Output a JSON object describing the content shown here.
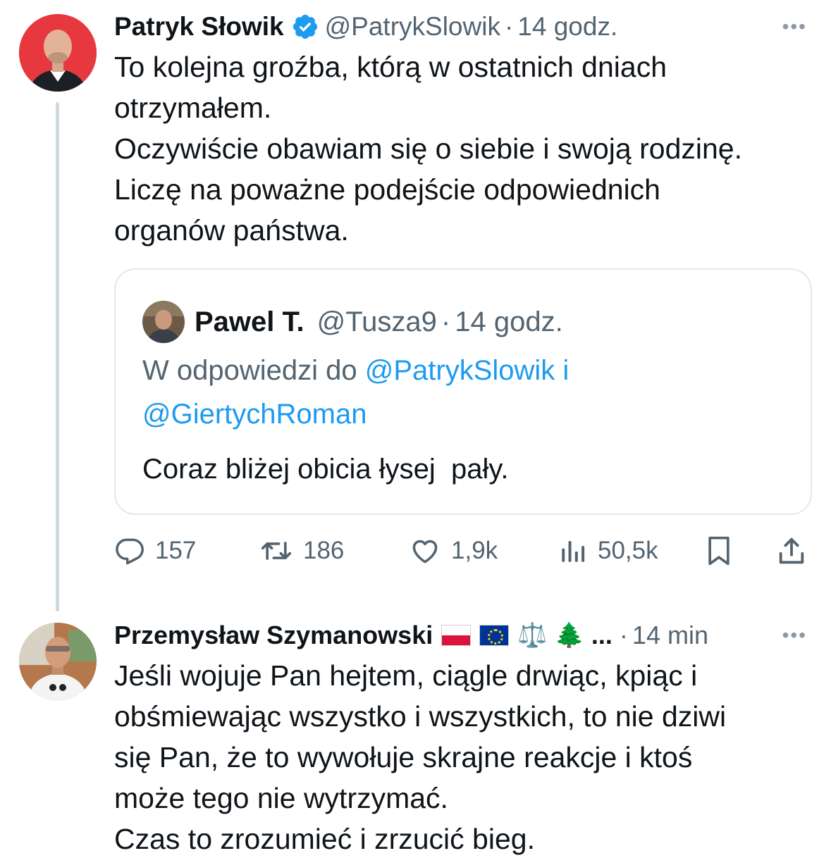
{
  "tweet1": {
    "author_name": "Patryk Słowik",
    "handle": "@PatrykSlowik",
    "separator": "·",
    "time": "14 godz.",
    "more": "•••",
    "text": "To kolejna groźba, którą w ostatnich dniach\notrzymałem.\nOczywiście obawiam się o siebie i swoją rodzinę.\nLiczę na poważne podejście odpowiednich\norganów państwa.",
    "quote": {
      "author_name": "Pawel T.",
      "handle": "@Tusza9",
      "separator": "·",
      "time": "14 godz.",
      "reply_prefix": "W odpowiedzi do ",
      "reply_mention_1": "@PatrykSlowik",
      "reply_conjunction": " i",
      "reply_mention_2": "@GiertychRoman",
      "text": "Coraz bliżej obicia łysej  pały."
    },
    "actions": {
      "replies": "157",
      "retweets": "186",
      "likes": "1,9k",
      "views": "50,5k"
    },
    "icons": [
      "verified-badge-icon",
      "reply-icon",
      "retweet-icon",
      "like-icon",
      "views-icon",
      "bookmark-icon",
      "share-icon"
    ]
  },
  "tweet2": {
    "author_name": "Przemysław Szymanowski",
    "name_emojis": [
      "⚖️",
      "🌲"
    ],
    "name_ellipsis": "...",
    "separator": "·",
    "time": "14 min",
    "more": "•••",
    "text": "Jeśli wojuje Pan hejtem, ciągle drwiąc, kpiąc i\nobśmiewając wszystko i wszystkich, to nie dziwi\nsię Pan, że to wywołuje skrajne reakcje i ktoś\nmoże tego nie wytrzymać.\nCzas to zrozumieć i zrzucić bieg."
  },
  "colors": {
    "accent_blue": "#1d9bf0",
    "text": "#0f1419",
    "muted": "#536471",
    "border": "#e3e8eb",
    "avatar1_bg": "#e8383f"
  }
}
